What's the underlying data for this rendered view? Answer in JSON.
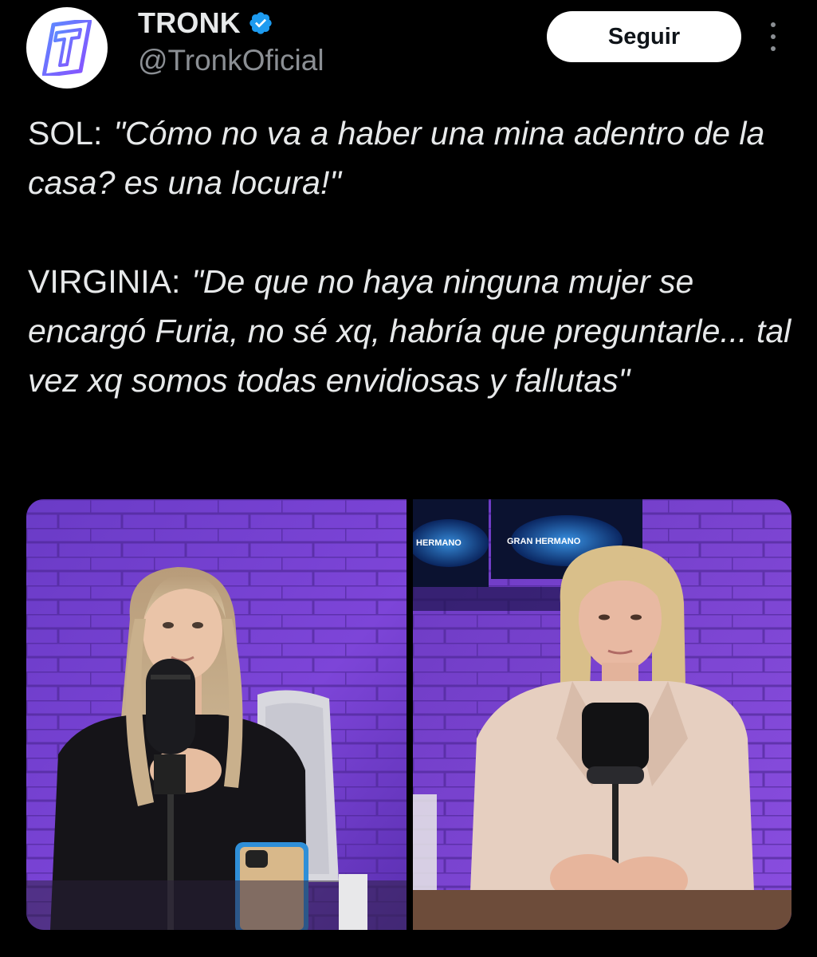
{
  "author": {
    "display_name": "TRONK",
    "handle": "@TronkOficial",
    "avatar_letter": "T",
    "verified": true,
    "verified_color": "#1d9bf0"
  },
  "actions": {
    "follow_label": "Seguir",
    "more_icon": "more-vertical-icon"
  },
  "tweet": {
    "paragraphs": [
      {
        "speaker": "SOL:",
        "quote": "\"Cómo no va a haber una mina adentro de la casa? es una locura!\""
      },
      {
        "speaker": "VIRGINIA:",
        "quote": "\"De que no haya ninguna mujer se encargó Furia, no sé xq, habría que preguntarle... tal vez xq somos todas envidiosas y fallutas\""
      }
    ]
  },
  "media": {
    "panels": [
      {
        "subject": "young woman with long blonde hair at microphone, purple brick wall"
      },
      {
        "subject": "older woman in beige jacket at microphone, Gran Hermano screen behind"
      }
    ],
    "screen_text": [
      "GRAN HERMANO",
      "HERMANO"
    ]
  },
  "colors": {
    "background": "#000000",
    "text": "#e7e9ea",
    "secondary": "#8b8f94",
    "accent_purple": "#7b3fd6"
  }
}
